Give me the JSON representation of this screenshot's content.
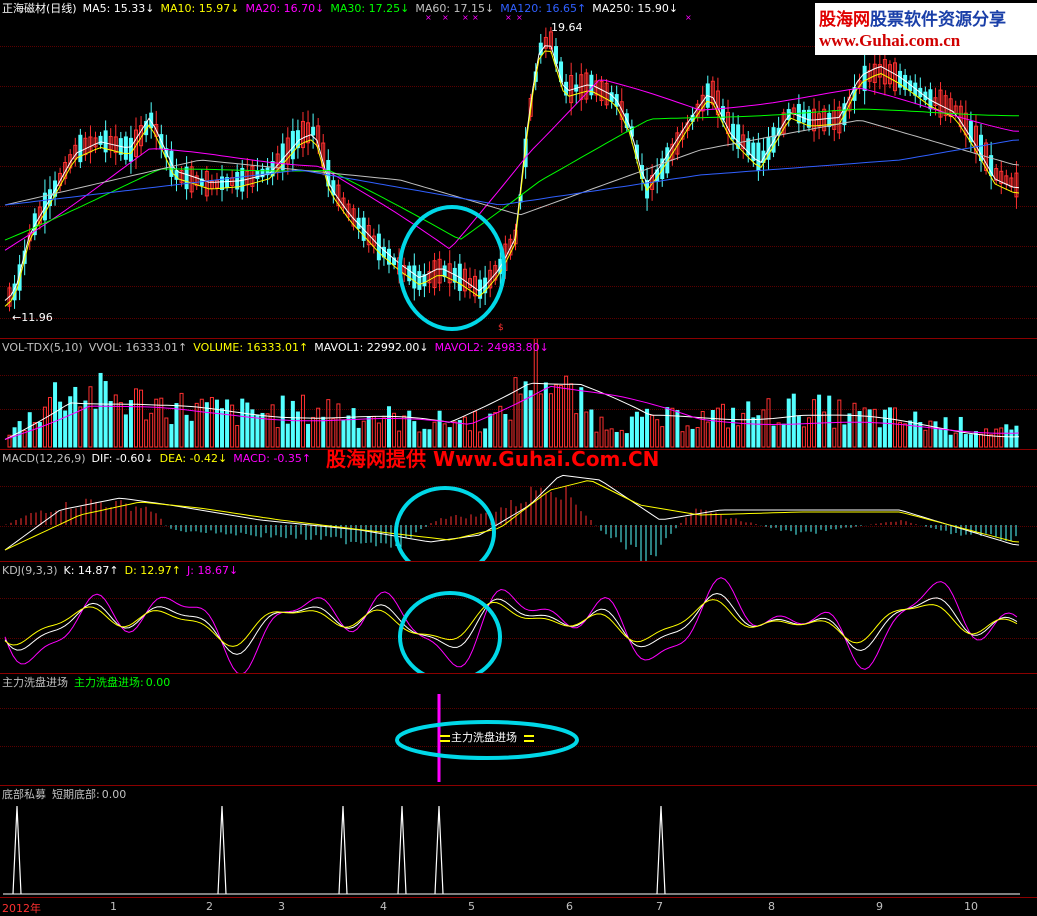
{
  "main": {
    "title": "正海磁材(日线)",
    "ma": [
      {
        "label": "MA5:",
        "value": "15.33",
        "arrow": "↓",
        "color": "#ffffff"
      },
      {
        "label": "MA10:",
        "value": "15.97",
        "arrow": "↓",
        "color": "#ffff00"
      },
      {
        "label": "MA20:",
        "value": "16.70",
        "arrow": "↓",
        "color": "#ff00ff"
      },
      {
        "label": "MA30:",
        "value": "17.25",
        "arrow": "↓",
        "color": "#00ff00"
      },
      {
        "label": "MA60:",
        "value": "17.15",
        "arrow": "↓",
        "color": "#c0c0c0"
      },
      {
        "label": "MA120:",
        "value": "16.65",
        "arrow": "↑",
        "color": "#3060ff"
      },
      {
        "label": "MA250:",
        "value": "15.90",
        "arrow": "↓",
        "color": "#ffffff"
      }
    ],
    "high_label": "19.64",
    "low_label": "11.96",
    "signal_mark": "$"
  },
  "vol": {
    "name": "VOL-TDX(5,10)",
    "items": [
      {
        "label": "VVOL:",
        "value": "16333.01",
        "arrow": "↑",
        "color": "#c0c0c0"
      },
      {
        "label": "VOLUME:",
        "value": "16333.01",
        "arrow": "↑",
        "color": "#ffff00"
      },
      {
        "label": "MAVOL1:",
        "value": "22992.00",
        "arrow": "↓",
        "color": "#ffffff"
      },
      {
        "label": "MAVOL2:",
        "value": "24983.80",
        "arrow": "↓",
        "color": "#ff00ff"
      }
    ]
  },
  "macd": {
    "name": "MACD(12,26,9)",
    "items": [
      {
        "label": "DIF:",
        "value": "-0.60",
        "arrow": "↓",
        "color": "#ffffff"
      },
      {
        "label": "DEA:",
        "value": "-0.42",
        "arrow": "↓",
        "color": "#ffff00"
      },
      {
        "label": "MACD:",
        "value": "-0.35",
        "arrow": "↑",
        "color": "#ff00ff"
      }
    ]
  },
  "kdj": {
    "name": "KDJ(9,3,3)",
    "items": [
      {
        "label": "K:",
        "value": "14.87",
        "arrow": "↑",
        "color": "#ffffff"
      },
      {
        "label": "D:",
        "value": "12.97",
        "arrow": "↑",
        "color": "#ffff00"
      },
      {
        "label": "J:",
        "value": "18.67",
        "arrow": "↓",
        "color": "#ff00ff"
      }
    ]
  },
  "wash": {
    "name": "主力洗盘进场",
    "item_label": "主力洗盘进场:",
    "item_value": "0.00",
    "signal_label": "主力洗盘进场"
  },
  "bottom": {
    "name": "底部私募",
    "item_label": "短期底部:",
    "item_value": "0.00"
  },
  "watermark": "股海网提供 Www.Guhai.Com.CN",
  "logo": {
    "top_red": "股海网",
    "top_blue": "股票软件资源分享",
    "bottom": "www.Guhai.com.cn"
  },
  "xaxis": [
    {
      "label": "2012年",
      "red": true
    },
    {
      "label": "1"
    },
    {
      "label": "2"
    },
    {
      "label": "3"
    },
    {
      "label": "4"
    },
    {
      "label": "5"
    },
    {
      "label": "6"
    },
    {
      "label": "7"
    },
    {
      "label": "8"
    },
    {
      "label": "9"
    },
    {
      "label": "10"
    }
  ],
  "colors": {
    "up": "#ff3030",
    "down": "#54ffff",
    "circle": "#00d8e8",
    "border": "#8b0000"
  }
}
